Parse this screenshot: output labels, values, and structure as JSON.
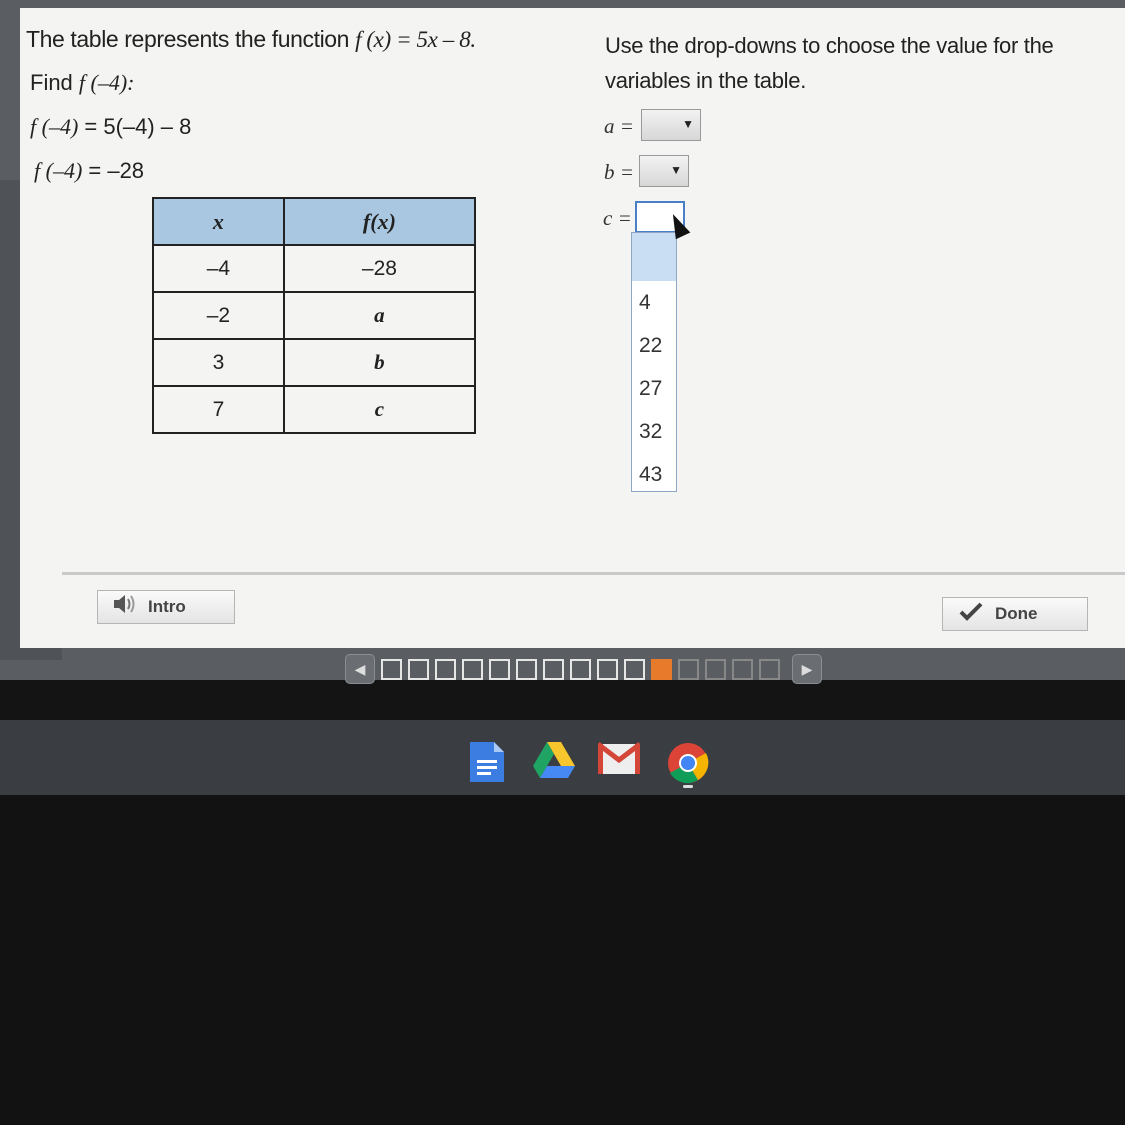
{
  "problem": {
    "statement_prefix": "The table represents the function ",
    "function_text": "f (x) = 5x – 8.",
    "find_label": "Find ",
    "find_text": "f (–4):",
    "step1_lhs": "f (–4)",
    "step1_rhs": " = 5(–4) – 8",
    "step2_lhs": "f (–4)",
    "step2_rhs": " = –28"
  },
  "instructions": "Use the drop-downs to choose the value for the variables in the table.",
  "table": {
    "headers": [
      "x",
      "f(x)"
    ],
    "rows": [
      {
        "x": "–4",
        "fx": "–28"
      },
      {
        "x": "–2",
        "fx": "a"
      },
      {
        "x": "3",
        "fx": "b"
      },
      {
        "x": "7",
        "fx": "c"
      }
    ]
  },
  "dropdowns": {
    "a_label": "a =",
    "b_label": "b =",
    "c_label": "c =",
    "options": [
      "4",
      "22",
      "27",
      "32",
      "43"
    ],
    "arrow": "▼"
  },
  "buttons": {
    "intro": "Intro",
    "done": "Done"
  },
  "icons": {
    "speaker": "speaker-icon",
    "check": "checkmark-icon",
    "prev": "◀",
    "next": "▶"
  },
  "progress": {
    "completed": 10,
    "current_index": 10,
    "total": 15
  },
  "colors": {
    "table_header": "#a9c7e0",
    "progress_current": "#e77b2b",
    "dropdown_focus": "#4a7fc6"
  }
}
